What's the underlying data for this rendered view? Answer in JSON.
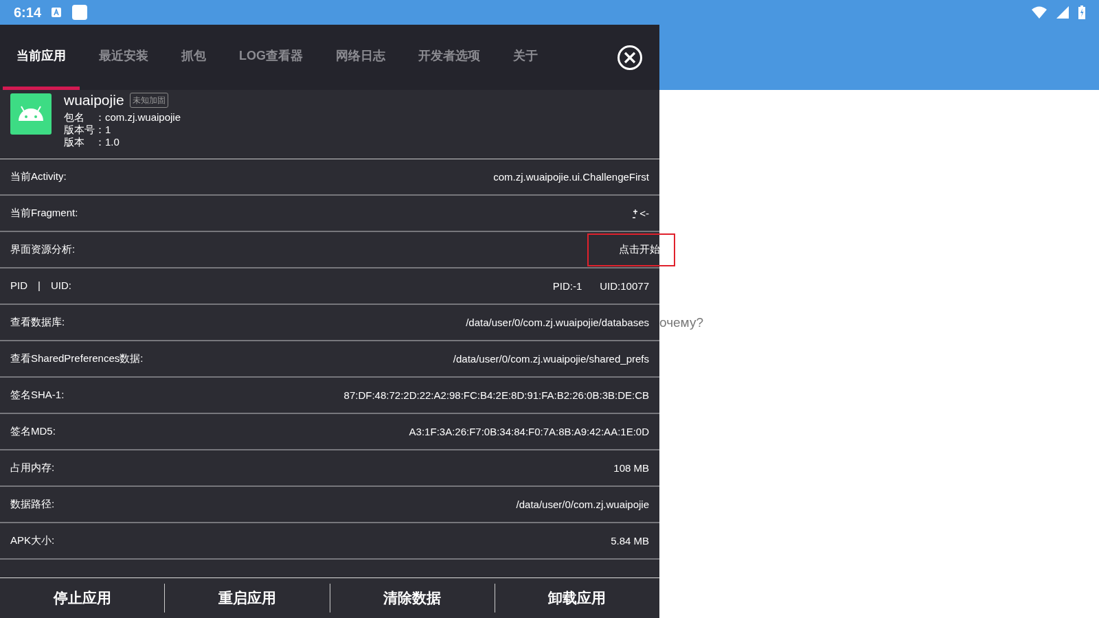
{
  "status_bar": {
    "time": "6:14"
  },
  "tabs": [
    {
      "label": "当前应用",
      "selected": true
    },
    {
      "label": "最近安装",
      "selected": false
    },
    {
      "label": "抓包",
      "selected": false
    },
    {
      "label": "LOG查看器",
      "selected": false
    },
    {
      "label": "网络日志",
      "selected": false
    },
    {
      "label": "开发者选项",
      "selected": false
    },
    {
      "label": "关于",
      "selected": false
    }
  ],
  "app": {
    "name": "wuaipojie",
    "badge": "未知加固",
    "details": [
      {
        "label": "包名　：",
        "value": "com.zj.wuaipojie"
      },
      {
        "label": "版本号：",
        "value": "1"
      },
      {
        "label": "版本　：",
        "value": "1.0"
      }
    ]
  },
  "rows": [
    {
      "label": "当前Activity:",
      "kind": "text",
      "value": "com.zj.wuaipojie.ui.ChallengeFirst"
    },
    {
      "label": "当前Fragment:",
      "kind": "glyph",
      "value": "<-"
    },
    {
      "label": "界面资源分析:",
      "kind": "action",
      "value": "点击开始"
    },
    {
      "label": "PID　|　UID:",
      "kind": "pair",
      "value": "PID:-1",
      "value_2": "UID:10077"
    },
    {
      "label": "查看数据库:",
      "kind": "text",
      "value": "/data/user/0/com.zj.wuaipojie/databases"
    },
    {
      "label": "查看SharedPreferences数据:",
      "kind": "text",
      "value": "/data/user/0/com.zj.wuaipojie/shared_prefs"
    },
    {
      "label": "签名SHA-1:",
      "kind": "text",
      "value": "87:DF:48:72:2D:22:A2:98:FC:B4:2E:8D:91:FA:B2:26:0B:3B:DE:CB"
    },
    {
      "label": "签名MD5:",
      "kind": "text",
      "value": "A3:1F:3A:26:F7:0B:34:84:F0:7A:8B:A9:42:AA:1E:0D"
    },
    {
      "label": "占用内存:",
      "kind": "text",
      "value": "108 MB"
    },
    {
      "label": "数据路径:",
      "kind": "text",
      "value": "/data/user/0/com.zj.wuaipojie"
    },
    {
      "label": "APK大小:",
      "kind": "text",
      "value": "5.84 MB"
    }
  ],
  "buttons": [
    "停止应用",
    "重启应用",
    "清除数据",
    "卸载应用"
  ],
  "background_text": "очему?"
}
